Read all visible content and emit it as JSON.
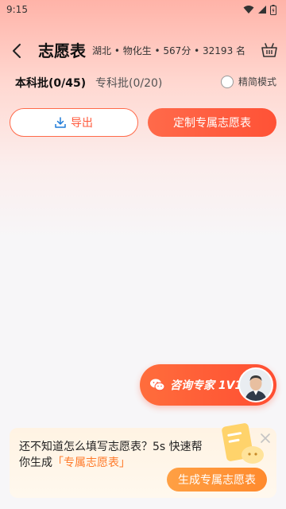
{
  "status_bar": {
    "time": "9:15"
  },
  "header": {
    "title": "志愿表",
    "subtitle": "湖北 • 物化生 • 567分 • 32193 名"
  },
  "tabs": {
    "undergrad": "本科批(0/45)",
    "specialist": "专科批(0/20)",
    "simple_mode": "精简模式"
  },
  "actions": {
    "export_label": "导出",
    "custom_label": "定制专属志愿表"
  },
  "consult": {
    "label": "咨询专家 1V1"
  },
  "promo": {
    "text_before": "还不知道怎么填写志愿表？5s 快速帮你生成",
    "highlight": "「专属志愿表」",
    "button_label": "生成专属志愿表"
  },
  "colors": {
    "accent": "#ff5a3c",
    "promo_button": "#ff8a2d"
  }
}
